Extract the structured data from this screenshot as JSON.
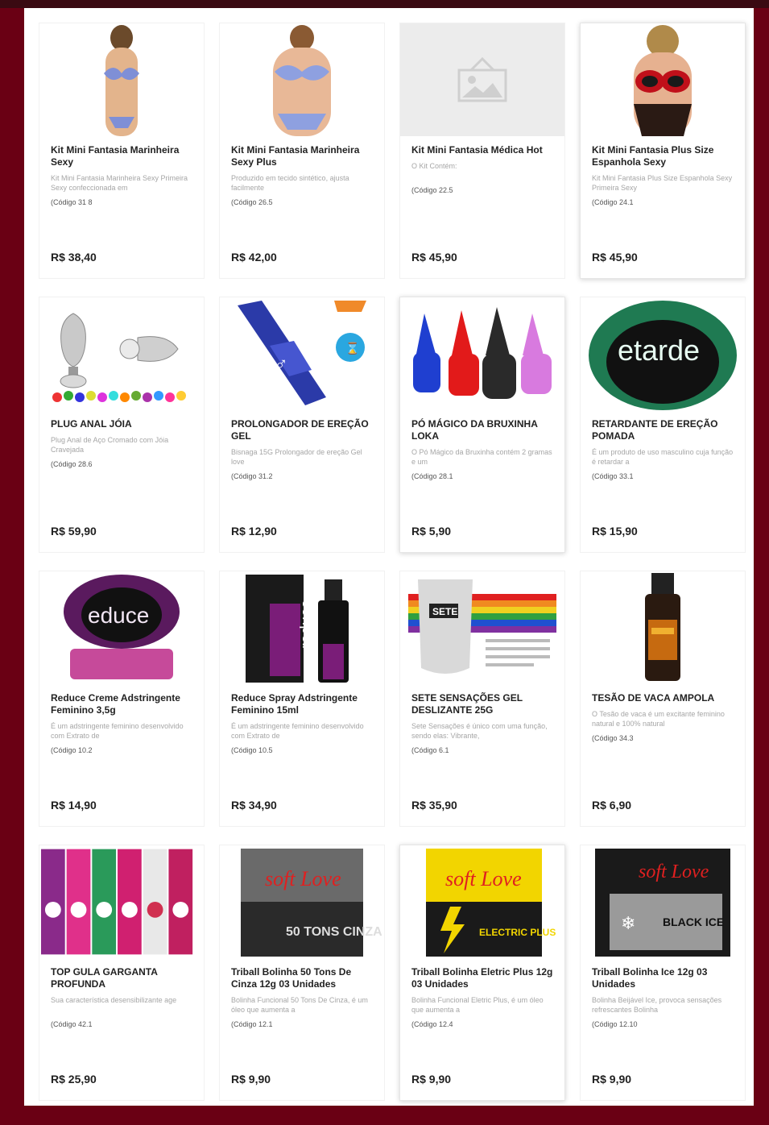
{
  "products": [
    {
      "name": "Kit Mini Fantasia Marinheira Sexy",
      "desc": "Kit Mini Fantasia Marinheira Sexy Primeira Sexy confeccionada em",
      "code": "(Código 31 8",
      "price": "R$ 38,40",
      "thumb": "bikini-blue-icon"
    },
    {
      "name": "Kit Mini Fantasia Marinheira Sexy Plus",
      "desc": "Produzido em tecido sintético, ajusta facilmente",
      "code": "(Código 26.5",
      "price": "R$ 42,00",
      "thumb": "bikini-blue-plus-icon"
    },
    {
      "name": "Kit Mini Fantasia Médica Hot",
      "desc": "O Kit Contém:",
      "code": "(Código 22.5",
      "price": "R$ 45,90",
      "thumb": "image-placeholder-icon"
    },
    {
      "name": "Kit Mini Fantasia Plus Size Espanhola Sexy",
      "desc": "Kit Mini Fantasia Plus Size Espanhola Sexy Primeira Sexy",
      "code": "(Código 24.1",
      "price": "R$ 45,90",
      "thumb": "lingerie-red-black-icon"
    },
    {
      "name": "PLUG ANAL JÓIA",
      "desc": "Plug Anal de Aço Cromado com Jóia Cravejada",
      "code": "(Código 28.6",
      "price": "R$ 59,90",
      "thumb": "metal-plug-jewels-icon"
    },
    {
      "name": "PROLONGADOR DE EREÇÃO GEL",
      "desc": "Bisnaga 15G Prolongador de ereção Gel love",
      "code": "(Código 31.2",
      "price": "R$ 12,90",
      "thumb": "blue-tube-icon"
    },
    {
      "name": "PÓ MÁGICO DA BRUXINHA LOKA",
      "desc": "O Pó Mágico da Bruxinha contém 2 gramas e um",
      "code": "(Código 28.1",
      "price": "R$ 5,90",
      "thumb": "witch-hats-icon"
    },
    {
      "name": "RETARDANTE DE EREÇÃO POMADA",
      "desc": "É um produto de uso masculino cuja função é retardar a",
      "code": "(Código 33.1",
      "price": "R$ 15,90",
      "thumb": "green-jar-retarde-icon"
    },
    {
      "name": "Reduce Creme Adstringente Feminino 3,5g",
      "desc": "É um adstringente feminino desenvolvido com Extrato de",
      "code": "(Código 10.2",
      "price": "R$ 14,90",
      "thumb": "purple-jar-reduce-icon"
    },
    {
      "name": "Reduce Spray Adstringente Feminino 15ml",
      "desc": "É um adstringente feminino desenvolvido com Extrato de",
      "code": "(Código 10.5",
      "price": "R$ 34,90",
      "thumb": "reduce-spray-box-icon"
    },
    {
      "name": "SETE SENSAÇÕES GEL DESLIZANTE 25G",
      "desc": "Sete Sensações é único com uma função, sendo elas: Vibrante,",
      "code": "(Código 6.1",
      "price": "R$ 35,90",
      "thumb": "rainbow-gel-box-icon"
    },
    {
      "name": "TESÃO DE VACA AMPOLA",
      "desc": "O Tesão de vaca é um excitante feminino natural e 100% natural",
      "code": "(Código 34.3",
      "price": "R$ 6,90",
      "thumb": "amber-ampoule-icon"
    },
    {
      "name": "TOP GULA GARGANTA PROFUNDA",
      "desc": "Sua característica desensibilizante age",
      "code": "(Código 42.1",
      "price": "R$ 25,90",
      "thumb": "colorful-boxes-icon"
    },
    {
      "name": "Triball Bolinha 50 Tons De Cinza 12g 03 Unidades",
      "desc": "Bolinha Funcional 50 Tons De Cinza, é um óleo que aumenta a",
      "code": "(Código 12.1",
      "price": "R$ 9,90",
      "thumb": "soft-love-gray-icon"
    },
    {
      "name": "Triball Bolinha Eletric Plus 12g 03 Unidades",
      "desc": "Bolinha Funcional Eletric Plus, é um óleo que aumenta a",
      "code": "(Código 12.4",
      "price": "R$ 9,90",
      "thumb": "soft-love-yellow-icon"
    },
    {
      "name": "Triball Bolinha Ice 12g 03 Unidades",
      "desc": "Bolinha Beijável Ice, provoca sensações refrescantes Bolinha",
      "code": "(Código 12.10",
      "price": "R$ 9,90",
      "thumb": "soft-love-black-ice-icon"
    }
  ],
  "thumb_text": {
    "retarde": "etarde",
    "reduce": "educe",
    "reduce_box": "reduce",
    "sete": "SETE",
    "soft_love": "soft Love",
    "gray_label": "50 TONS CINZA",
    "yellow_label": "ELECTRIC PLUS",
    "black_label": "BLACK ICE"
  },
  "colors": {
    "frame": "#6a0014",
    "panel": "#ffffff",
    "price": "#222222",
    "muted": "#a6a6a6"
  }
}
